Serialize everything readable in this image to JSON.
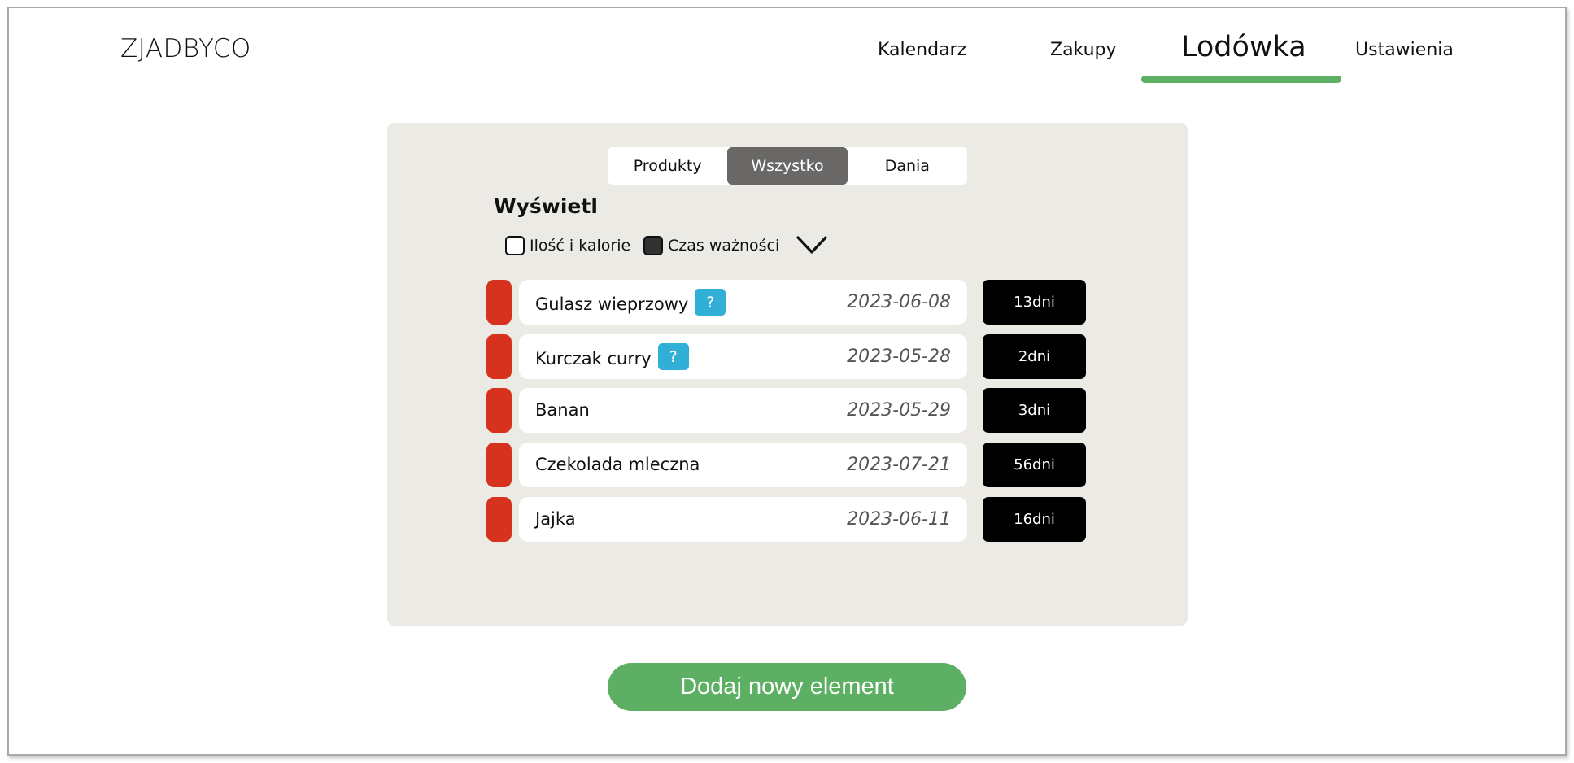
{
  "app": {
    "logo": "ZJADBYCO"
  },
  "nav": {
    "items": [
      {
        "label": "Kalendarz"
      },
      {
        "label": "Zakupy"
      },
      {
        "label": "Lodówka",
        "active": true
      },
      {
        "label": "Ustawienia"
      }
    ],
    "accent_color": "#5daf63"
  },
  "tabs": {
    "items": [
      {
        "label": "Produkty"
      },
      {
        "label": "Wszystko",
        "active": true
      },
      {
        "label": "Dania"
      }
    ]
  },
  "display": {
    "title": "Wyświetl",
    "options": [
      {
        "label": "Ilość i kalorie",
        "checked": false
      },
      {
        "label": "Czas ważności",
        "checked": true
      }
    ],
    "expand_icon": "chevron-down-icon"
  },
  "items": [
    {
      "name": "Gulasz wieprzowy",
      "help": "?",
      "date": "2023-06-08",
      "days": "13dni"
    },
    {
      "name": "Kurczak curry",
      "help": "?",
      "date": "2023-05-28",
      "days": "2dni"
    },
    {
      "name": "Banan",
      "date": "2023-05-29",
      "days": "3dni"
    },
    {
      "name": "Czekolada mleczna",
      "date": "2023-07-21",
      "days": "56dni"
    },
    {
      "name": "Jajka",
      "date": "2023-06-11",
      "days": "16dni"
    }
  ],
  "colors": {
    "marker": "#d7321e",
    "help_badge": "#31afd6",
    "panel": "#ebeae5"
  },
  "add_button": {
    "label": "Dodaj nowy element"
  }
}
